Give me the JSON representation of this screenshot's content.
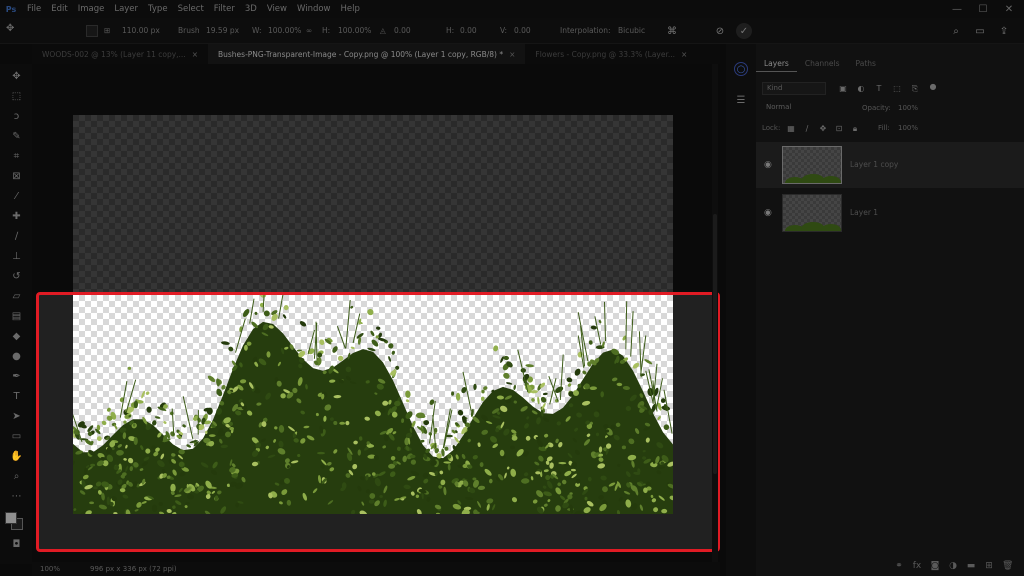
{
  "app": {
    "logo": "Ps"
  },
  "menu": [
    "File",
    "Edit",
    "Image",
    "Layer",
    "Type",
    "Select",
    "Filter",
    "3D",
    "View",
    "Window",
    "Help"
  ],
  "window_controls": [
    "—",
    "☐",
    "✕"
  ],
  "options": {
    "size": "110.00 px",
    "brush_label": "Brush",
    "brush_value": "19.59 px",
    "width_pct": "100.00%",
    "height_pct": "100.00%",
    "angle": "0.00",
    "h_skew": "0.00",
    "v_skew": "0.00",
    "interpolation_label": "Interpolation:",
    "interpolation_value": "Bicubic"
  },
  "tabs": [
    {
      "label": "WOODS-002 @ 13% (Layer 11 copy,...",
      "active": false
    },
    {
      "label": "Bushes-PNG-Transparent-Image - Copy.png @ 100% (Layer 1 copy, RGB/8) *",
      "active": true
    },
    {
      "label": "Flowers - Copy.png @ 33.3% (Layer...",
      "active": false
    }
  ],
  "status": {
    "zoom": "100%",
    "doc_info": "996 px x 336 px (72 ppi)"
  },
  "panel": {
    "tabs": [
      "Layers",
      "Channels",
      "Paths"
    ],
    "active_tab": "Layers",
    "kind_filter": "Kind",
    "blend_mode": "Normal",
    "opacity_label": "Opacity:",
    "opacity_value": "100%",
    "lock_label": "Lock:",
    "fill_label": "Fill:",
    "fill_value": "100%",
    "layers": [
      {
        "name": "Layer 1 copy",
        "visible": true,
        "selected": true
      },
      {
        "name": "Layer 1",
        "visible": true,
        "selected": false
      }
    ]
  },
  "colors": {
    "highlight": "#e01b24",
    "foliage_dark": "#2f4a12",
    "foliage_light": "#7a9a3a"
  }
}
